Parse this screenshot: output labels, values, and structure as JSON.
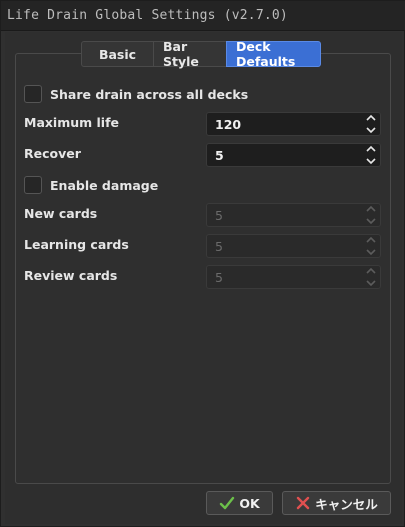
{
  "window": {
    "title": "Life Drain Global Settings (v2.7.0)"
  },
  "tabs": [
    {
      "label": "Basic",
      "active": false
    },
    {
      "label": "Bar Style",
      "active": false
    },
    {
      "label": "Deck Defaults",
      "active": true
    }
  ],
  "settings": {
    "share_drain": {
      "label": "Share drain across all decks",
      "checked": false
    },
    "maximum_life": {
      "label": "Maximum life",
      "value": "120",
      "enabled": true
    },
    "recover": {
      "label": "Recover",
      "value": "5",
      "enabled": true
    },
    "enable_damage": {
      "label": "Enable damage",
      "checked": false
    },
    "new_cards": {
      "label": "New cards",
      "value": "5",
      "enabled": false
    },
    "learning_cards": {
      "label": "Learning cards",
      "value": "5",
      "enabled": false
    },
    "review_cards": {
      "label": "Review cards",
      "value": "5",
      "enabled": false
    }
  },
  "footer": {
    "ok_label": "OK",
    "ok_icon": "checkmark-icon",
    "cancel_label": "キャンセル",
    "cancel_icon": "x-icon"
  },
  "colors": {
    "accent": "#3b6fd4",
    "ok_icon": "#6cc04a",
    "cancel_icon": "#e05050"
  }
}
